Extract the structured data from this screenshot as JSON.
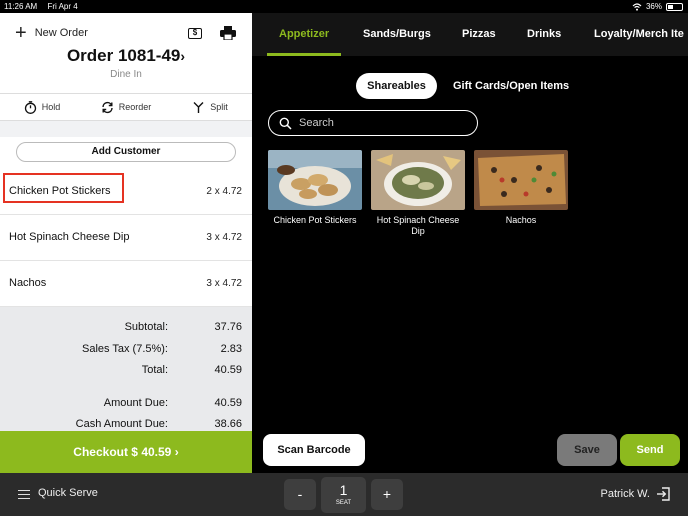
{
  "status_bar": {
    "time": "11:26 AM",
    "date": "Fri Apr 4",
    "battery": "36%"
  },
  "order_header": {
    "new_order_label": "New Order",
    "order_title": "Order 1081-49",
    "order_type": "Dine In"
  },
  "actions": [
    {
      "label": "Hold",
      "icon": "timer-icon"
    },
    {
      "label": "Reorder",
      "icon": "reorder-icon"
    },
    {
      "label": "Split",
      "icon": "split-icon"
    }
  ],
  "add_customer_label": "Add Customer",
  "order_items": [
    {
      "name": "Chicken Pot Stickers",
      "qty": "2 x 4.72"
    },
    {
      "name": "Hot Spinach Cheese Dip",
      "qty": "3 x 4.72"
    },
    {
      "name": "Nachos",
      "qty": "3 x 4.72"
    }
  ],
  "totals": [
    {
      "label": "Subtotal:",
      "value": "37.76"
    },
    {
      "label": "Sales Tax (7.5%):",
      "value": "2.83"
    },
    {
      "label": "Total:",
      "value": "40.59"
    },
    {
      "label": "Amount Due:",
      "value": "40.59"
    },
    {
      "label": "Cash Amount Due:",
      "value": "38.66"
    }
  ],
  "checkout_label": "Checkout $ 40.59",
  "categories": [
    "Appetizer",
    "Sands/Burgs",
    "Pizzas",
    "Drinks",
    "Loyalty/Merch Ite"
  ],
  "active_category": "Appetizer",
  "subcategories": [
    "Shareables",
    "Gift Cards/Open Items"
  ],
  "search_placeholder": "Search",
  "menu_items": [
    {
      "name": "Chicken Pot Stickers"
    },
    {
      "name": "Hot Spinach Cheese Dip"
    },
    {
      "name": "Nachos"
    }
  ],
  "buttons": {
    "scan": "Scan Barcode",
    "save": "Save",
    "send": "Send"
  },
  "bottom_bar": {
    "mode_label": "Quick Serve",
    "minus": "-",
    "seat_number": "1",
    "seat_label": "SEAT",
    "plus": "+",
    "user": "Patrick W."
  },
  "colors": {
    "accent": "#8dba1e",
    "highlight": "#e53222"
  }
}
